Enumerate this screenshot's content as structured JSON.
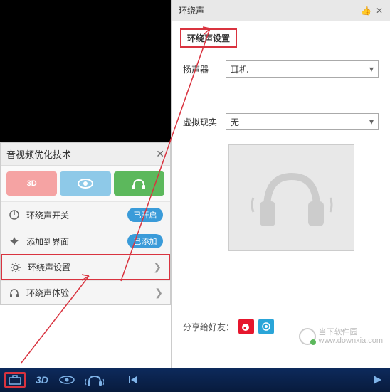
{
  "popup": {
    "title": "音视频优化技术",
    "tabs": {
      "t3d": "3D",
      "eye": "eye",
      "headphone": "headphone"
    },
    "rows": {
      "switch": {
        "label": "环绕声开关",
        "toggle": "已开启"
      },
      "add": {
        "label": "添加到界面",
        "toggle": "已添加"
      },
      "settings": {
        "label": "环绕声设置"
      },
      "experience": {
        "label": "环绕声体验"
      }
    }
  },
  "right": {
    "header_title": "环绕声",
    "section_title": "环绕声设置",
    "speaker_label": "扬声器",
    "speaker_value": "耳机",
    "vr_label": "虚拟现实",
    "vr_value": "无",
    "share_label": "分享给好友："
  },
  "watermark": {
    "line1": "当下软件园",
    "line2": "www.downxia.com"
  },
  "bottom": {
    "t3d": "3D"
  }
}
